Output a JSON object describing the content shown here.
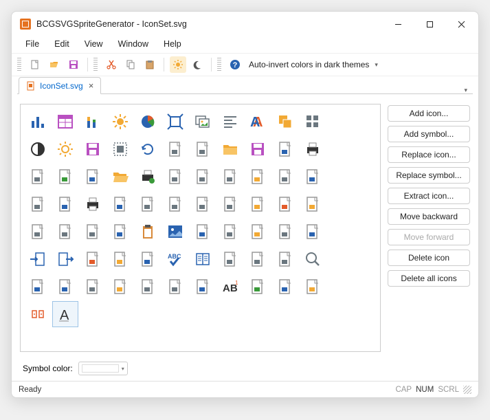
{
  "window": {
    "title": "BCGSVGSpriteGenerator - IconSet.svg"
  },
  "menu": {
    "file": "File",
    "edit": "Edit",
    "view": "View",
    "window": "Window",
    "help": "Help"
  },
  "toolbar": {
    "auto_invert": "Auto-invert colors in dark themes"
  },
  "tab": {
    "name": "IconSet.svg"
  },
  "sidebar": {
    "add_icon": "Add icon...",
    "add_symbol": "Add symbol...",
    "replace_icon": "Replace icon...",
    "replace_symbol": "Replace symbol...",
    "extract_icon": "Extract icon...",
    "move_backward": "Move backward",
    "move_forward": "Move forward",
    "delete_icon": "Delete icon",
    "delete_all": "Delete all icons"
  },
  "bottom": {
    "symbol_color": "Symbol color:"
  },
  "status": {
    "ready": "Ready",
    "cap": "CAP",
    "num": "NUM",
    "scrl": "SCRL"
  },
  "icons": [
    {
      "name": "bar-chart",
      "c": "#2a63b0"
    },
    {
      "name": "table-chart",
      "c": "#b950c1"
    },
    {
      "name": "stacked-bars",
      "c": "#2a63b0"
    },
    {
      "name": "sun",
      "c": "#f2a934"
    },
    {
      "name": "pie-chart",
      "c": "#2a63b0"
    },
    {
      "name": "fit-width",
      "c": "#2a63b0"
    },
    {
      "name": "images",
      "c": "#6b777f"
    },
    {
      "name": "align-left",
      "c": "#6b777f"
    },
    {
      "name": "font-a",
      "c": "#2a63b0"
    },
    {
      "name": "layers",
      "c": "#f2a934"
    },
    {
      "name": "tiles",
      "c": "#6b777f"
    },
    {
      "name": "blank",
      "c": "transparent"
    },
    {
      "name": "contrast",
      "c": "#333"
    },
    {
      "name": "brightness",
      "c": "#f2a934"
    },
    {
      "name": "floppy",
      "c": "#b950c1"
    },
    {
      "name": "group",
      "c": "#6b777f"
    },
    {
      "name": "rotate",
      "c": "#2a63b0"
    },
    {
      "name": "image-doc",
      "c": "#6b777f"
    },
    {
      "name": "doc",
      "c": "#6b777f"
    },
    {
      "name": "folder",
      "c": "#f2a934"
    },
    {
      "name": "floppy2",
      "c": "#b950c1"
    },
    {
      "name": "edit-doc",
      "c": "#2a63b0"
    },
    {
      "name": "printer",
      "c": "#333"
    },
    {
      "name": "blank",
      "c": "transparent"
    },
    {
      "name": "form-check",
      "c": "#6b777f"
    },
    {
      "name": "user-doc",
      "c": "#3a9a3a"
    },
    {
      "name": "grid-up",
      "c": "#2a63b0"
    },
    {
      "name": "folder-open",
      "c": "#f2a934"
    },
    {
      "name": "print-doc",
      "c": "#3a9a3a"
    },
    {
      "name": "search-doc",
      "c": "#6b777f"
    },
    {
      "name": "info-doc",
      "c": "#6b777f"
    },
    {
      "name": "list-doc",
      "c": "#6b777f"
    },
    {
      "name": "lock-doc",
      "c": "#f2a934"
    },
    {
      "name": "break-doc",
      "c": "#6b777f"
    },
    {
      "name": "word-doc",
      "c": "#2a63b0"
    },
    {
      "name": "blank",
      "c": "transparent"
    },
    {
      "name": "attach",
      "c": "#6b777f"
    },
    {
      "name": "image2",
      "c": "#2a63b0"
    },
    {
      "name": "print2",
      "c": "#6b777f"
    },
    {
      "name": "user-doc2",
      "c": "#2a63b0"
    },
    {
      "name": "grid-expand",
      "c": "#6b777f"
    },
    {
      "name": "text-doc",
      "c": "#6b777f"
    },
    {
      "name": "check-doc",
      "c": "#6b777f"
    },
    {
      "name": "lines",
      "c": "#6b777f"
    },
    {
      "name": "ref-doc",
      "c": "#f2a934"
    },
    {
      "name": "a-doc",
      "c": "#e35b2a"
    },
    {
      "name": "arrow-doc",
      "c": "#f2a934"
    },
    {
      "name": "blank",
      "c": "transparent"
    },
    {
      "name": "equals-doc",
      "c": "#6b777f"
    },
    {
      "name": "doc2",
      "c": "#6b777f"
    },
    {
      "name": "layers2",
      "c": "#6b777f"
    },
    {
      "name": "bar-doc",
      "c": "#2a63b0"
    },
    {
      "name": "clipboard",
      "c": "#f2a934"
    },
    {
      "name": "picture",
      "c": "#2a63b0"
    },
    {
      "name": "check-page",
      "c": "#2a63b0"
    },
    {
      "name": "list-page",
      "c": "#6b777f"
    },
    {
      "name": "tag-page",
      "c": "#f2a934"
    },
    {
      "name": "arrow-page",
      "c": "#6b777f"
    },
    {
      "name": "search-page",
      "c": "#2a63b0"
    },
    {
      "name": "blank",
      "c": "transparent"
    },
    {
      "name": "import",
      "c": "#2a63b0"
    },
    {
      "name": "export",
      "c": "#2a63b0"
    },
    {
      "name": "x-doc",
      "c": "#e35b2a"
    },
    {
      "name": "lock-page",
      "c": "#f2a934"
    },
    {
      "name": "num-page",
      "c": "#2a63b0"
    },
    {
      "name": "abc-check",
      "c": "#2a63b0"
    },
    {
      "name": "book",
      "c": "#2a63b0"
    },
    {
      "name": "split-page",
      "c": "#6b777f"
    },
    {
      "name": "lang-page",
      "c": "#6b777f"
    },
    {
      "name": "web-page",
      "c": "#6b777f"
    },
    {
      "name": "magnifier",
      "c": "#6b777f"
    },
    {
      "name": "blank",
      "c": "transparent"
    },
    {
      "name": "down-panel",
      "c": "#2a63b0"
    },
    {
      "name": "half-panel",
      "c": "#2a63b0"
    },
    {
      "name": "form-copy",
      "c": "#6b777f"
    },
    {
      "name": "windows",
      "c": "#f2a934"
    },
    {
      "name": "user-edit",
      "c": "#6b777f"
    },
    {
      "name": "form-equal",
      "c": "#6b777f"
    },
    {
      "name": "form-grid",
      "c": "#2a63b0"
    },
    {
      "name": "ab1",
      "c": "#333"
    },
    {
      "name": "plus-page",
      "c": "#3a9a3a"
    },
    {
      "name": "img-page",
      "c": "#2a63b0"
    },
    {
      "name": "link-page",
      "c": "#f2a934"
    },
    {
      "name": "blank",
      "c": "transparent"
    },
    {
      "name": "tag-sym",
      "c": "#e35b2a"
    },
    {
      "name": "a-glyph",
      "c": "#333",
      "sel": true
    }
  ]
}
